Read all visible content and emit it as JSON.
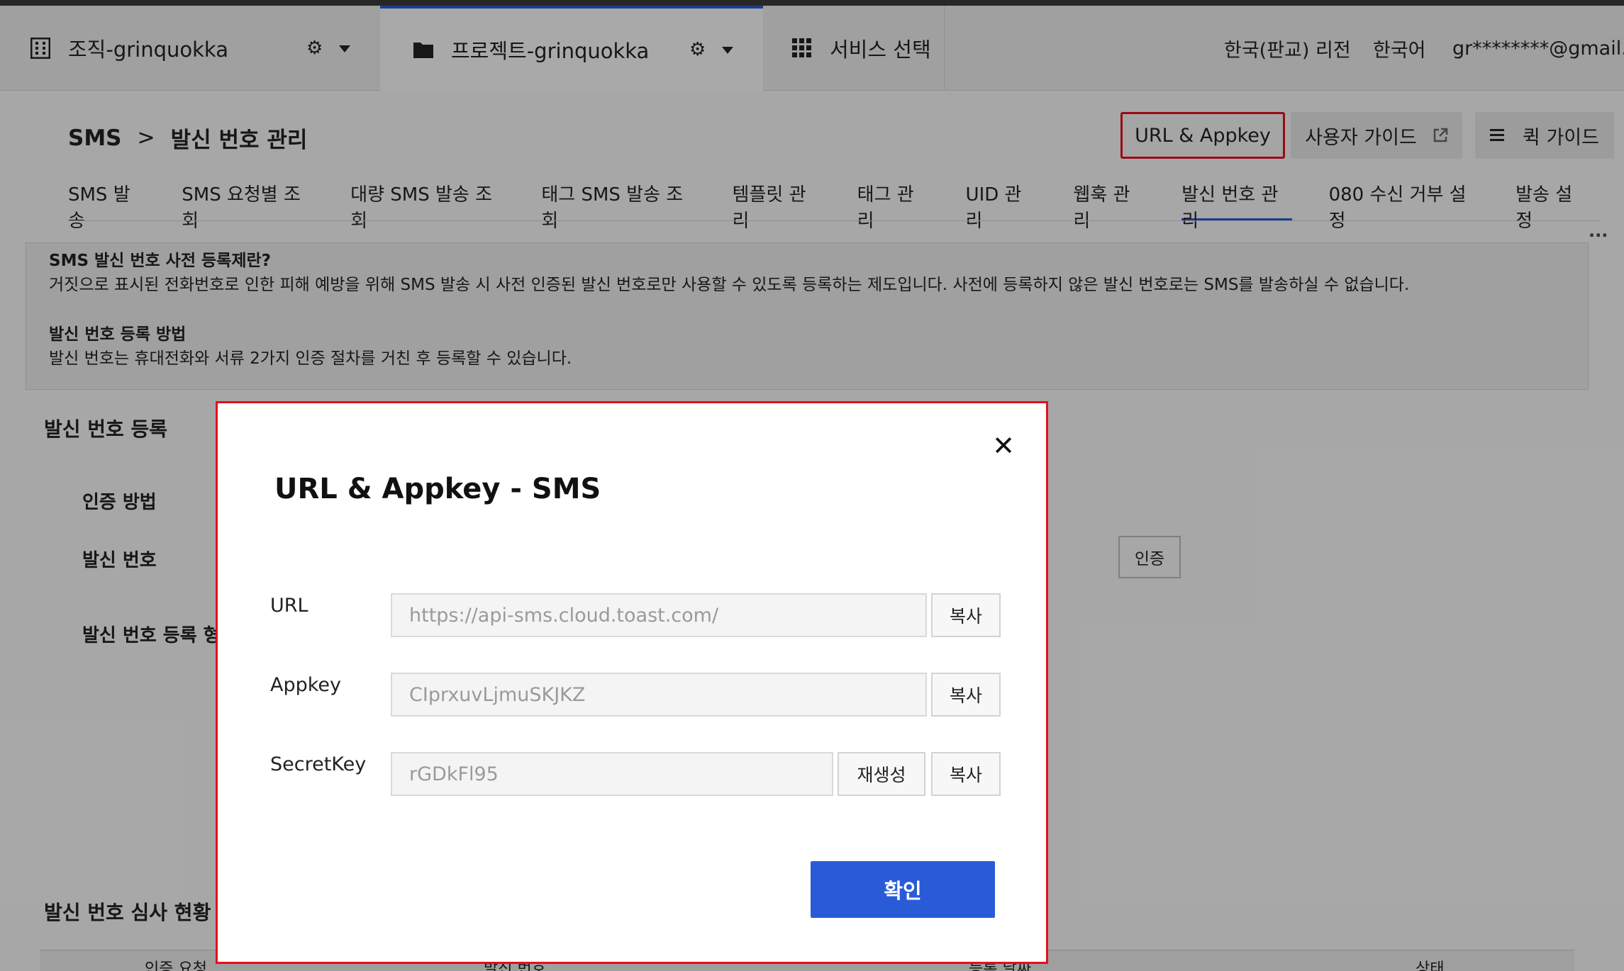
{
  "gnb": {
    "org": {
      "label": "조직-grinquokka",
      "icon": "building-icon"
    },
    "project": {
      "label": "프로젝트-grinquokka",
      "icon": "folder-icon"
    },
    "service": {
      "label": "서비스 선택",
      "icon": "grid-icon"
    },
    "region": "한국(판교) 리전",
    "language": "한국어",
    "user": "gr********@gmail.co",
    "accent_color": "#2a5bd7"
  },
  "header": {
    "breadcrumb": [
      "SMS",
      "발신 번호 관리"
    ],
    "url_appkey_label": "URL & Appkey",
    "user_guide_label": "사용자 가이드",
    "quick_guide_label": "퀵 가이드"
  },
  "tabs": [
    {
      "label": "SMS 발송"
    },
    {
      "label": "SMS 요청별 조회"
    },
    {
      "label": "대량 SMS 발송 조회"
    },
    {
      "label": "태그 SMS 발송 조회"
    },
    {
      "label": "템플릿 관리"
    },
    {
      "label": "태그 관리"
    },
    {
      "label": "UID 관리"
    },
    {
      "label": "웹훅 관리"
    },
    {
      "label": "발신 번호 관리",
      "active": true
    },
    {
      "label": "080 수신 거부 설정"
    },
    {
      "label": "발송 설정"
    }
  ],
  "notice": {
    "title1": "SMS 발신 번호 사전 등록제란?",
    "body1": "거짓으로 표시된 전화번호로 인한 피해 예방을 위해 SMS 발송 시 사전 인증된 발신 번호로만 사용할 수 있도록 등록하는 제도입니다. 사전에 등록하지 않은 발신 번호로는 SMS를 발송하실 수 없습니다.",
    "title2": "발신 번호 등록 방법",
    "body2": "발신 번호는 휴대전화와 서류 2가지 인증 절차를 거친 후 등록할 수 있습니다."
  },
  "form": {
    "section_title": "발신 번호 등록",
    "auth_method_label": "인증 방법",
    "sender_number_label": "발신 번호",
    "register_form_label": "발신 번호 등록 형",
    "verify_button": "인증",
    "review_title": "발신 번호 심사 현황",
    "table_headers": [
      "인증 요청",
      "발신 번호",
      "등록 날짜",
      "상태"
    ]
  },
  "modal": {
    "title": "URL & Appkey - SMS",
    "url_label": "URL",
    "url_value": "https://api-sms.cloud.toast.com/",
    "appkey_label": "Appkey",
    "appkey_value": "CIprxuvLjmuSKJKZ",
    "secret_label": "SecretKey",
    "secret_value": "rGDkFl95",
    "copy_label": "복사",
    "regenerate_label": "재생성",
    "confirm_label": "확인",
    "confirm_color": "#2a5bd7",
    "highlight_color": "#e3101d"
  }
}
